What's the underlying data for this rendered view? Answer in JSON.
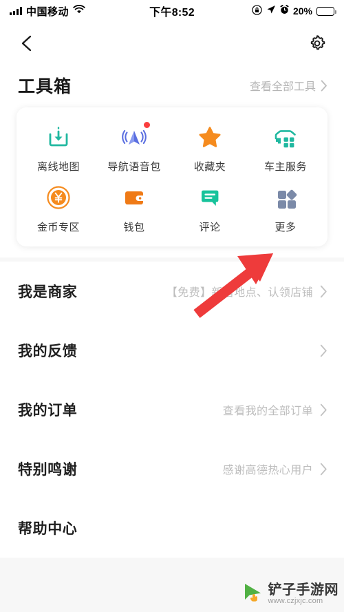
{
  "status_bar": {
    "carrier": "中国移动",
    "time": "下午8:52",
    "battery_percent": "20%",
    "signal_icon": "signal-bars-icon",
    "wifi_icon": "wifi-icon",
    "rotation_lock_icon": "rotation-lock-icon",
    "location_icon": "location-arrow-icon",
    "alarm_icon": "alarm-clock-icon",
    "battery_icon": "battery-low-icon",
    "battery_color": "#ff2d2d"
  },
  "nav": {
    "back_icon": "back-chevron-icon",
    "settings_icon": "gear-icon"
  },
  "header": {
    "title": "工具箱",
    "see_all": "查看全部工具",
    "see_all_chevron": "chevron-right-icon"
  },
  "tools": [
    {
      "label": "离线地图",
      "icon": "offline-map-download-icon",
      "color": "#20b8a0",
      "badge": false
    },
    {
      "label": "导航语音包",
      "icon": "navigation-voice-icon",
      "color": "#5b6fe0",
      "badge": true
    },
    {
      "label": "收藏夹",
      "icon": "star-favorite-icon",
      "color": "#f58b1e",
      "badge": false
    },
    {
      "label": "车主服务",
      "icon": "car-service-icon",
      "color": "#20b8a0",
      "badge": false
    },
    {
      "label": "金币专区",
      "icon": "gold-coin-icon",
      "color": "#f58b1e",
      "badge": false
    },
    {
      "label": "钱包",
      "icon": "wallet-icon",
      "color": "#ef7a16",
      "badge": false
    },
    {
      "label": "评论",
      "icon": "comment-bubble-icon",
      "color": "#17c39b",
      "badge": false
    },
    {
      "label": "更多",
      "icon": "more-grid-icon",
      "color": "#7b8aa8",
      "badge": false
    }
  ],
  "list_rows": [
    {
      "label": "我是商家",
      "value": "【免费】新增地点、认领店铺"
    },
    {
      "label": "我的反馈",
      "value": ""
    },
    {
      "label": "我的订单",
      "value": "查看我的全部订单"
    },
    {
      "label": "特别鸣谢",
      "value": "感谢高德热心用户"
    },
    {
      "label": "帮助中心",
      "value": ""
    }
  ],
  "annotation": {
    "arrow_color": "#ee3b3b",
    "points_to": "更多"
  },
  "watermark": {
    "name": "铲子手游网",
    "url": "www.czjxjc.com",
    "logo_icon": "green-cursor-logo-icon",
    "logo_color": "#4caf3f"
  }
}
